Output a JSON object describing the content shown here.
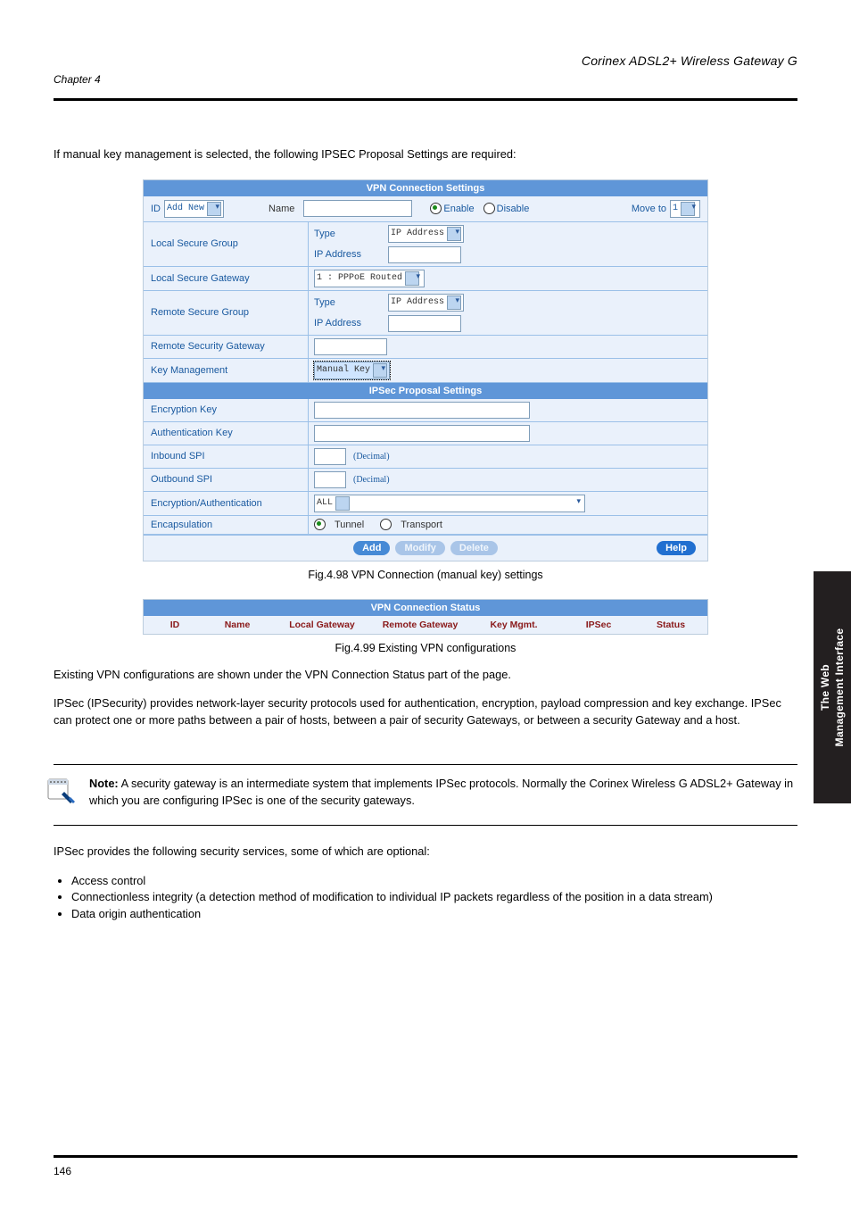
{
  "header": {
    "product": "Corinex ADSL2+ Wireless Gateway G",
    "chapter": "Chapter 4"
  },
  "intro": "If manual key management is selected, the following IPSEC Proposal Settings are required:",
  "screenshot": {
    "title": "VPN Connection Settings",
    "id_row": {
      "id_label": "ID",
      "id_select": "Add New",
      "name_label": "Name",
      "name_value": "",
      "enable_label": "Enable",
      "disable_label": "Disable",
      "enable_checked": true,
      "moveto_label": "Move to",
      "moveto_value": "1"
    },
    "local_secure_group": {
      "label": "Local Secure Group",
      "type_label": "Type",
      "type_value": "IP Address",
      "ip_label": "IP Address",
      "ip_value": ""
    },
    "local_secure_gateway": {
      "label": "Local Secure Gateway",
      "value": "1 : PPPoE Routed"
    },
    "remote_secure_group": {
      "label": "Remote Secure Group",
      "type_label": "Type",
      "type_value": "IP Address",
      "ip_label": "IP Address",
      "ip_value": ""
    },
    "remote_security_gateway": {
      "label": "Remote Security Gateway",
      "value": ""
    },
    "key_management": {
      "label": "Key Management",
      "value": "Manual Key"
    },
    "ipsec_title": "IPSec Proposal Settings",
    "encryption_key": {
      "label": "Encryption Key",
      "value": ""
    },
    "authentication_key": {
      "label": "Authentication Key",
      "value": ""
    },
    "inbound_spi": {
      "label": "Inbound SPI",
      "value": "",
      "suffix": "(Decimal)"
    },
    "outbound_spi": {
      "label": "Outbound SPI",
      "value": "",
      "suffix": "(Decimal)"
    },
    "enc_auth": {
      "label": "Encryption/Authentication",
      "value": "ALL"
    },
    "encapsulation": {
      "label": "Encapsulation",
      "tunnel": "Tunnel",
      "transport": "Transport",
      "tunnel_checked": true
    },
    "buttons": {
      "add": "Add",
      "modify": "Modify",
      "delete": "Delete",
      "help": "Help"
    }
  },
  "fig1": "Fig.4.98 VPN Connection (manual key) settings",
  "status_shot": {
    "title": "VPN Connection Status",
    "cols": [
      "ID",
      "Name",
      "Local Gateway",
      "Remote Gateway",
      "Key Mgmt.",
      "IPSec",
      "Status"
    ]
  },
  "fig2": "Fig.4.99 Existing VPN configurations",
  "after_status_para": "Existing VPN configurations are shown under the VPN Connection Status part of the page.",
  "ipsec_para1": "IPSec (IPSecurity) provides network-layer security protocols used for authentication, encryption, payload compression and key exchange. IPSec can protect one or more paths between a pair of hosts, between a pair of security Gateways, or between a security Gateway and a host.",
  "note": {
    "prefix": "Note:",
    "body": " A security gateway is an intermediate system that implements IPSec protocols. Normally the Corinex Wireless G ADSL2+ Gateway in which you are configuring IPSec is one of the security gateways."
  },
  "ipsec_para2": "IPSec provides the following security services, some of which are optional:",
  "bullets": [
    "Access control",
    "Connectionless integrity (a detection method of modification to individual IP packets regardless of the position in a data stream)",
    "Data origin authentication"
  ],
  "sidebar": {
    "line1": "The Web",
    "line2": "Management Interface"
  },
  "footer": {
    "page": "146"
  }
}
